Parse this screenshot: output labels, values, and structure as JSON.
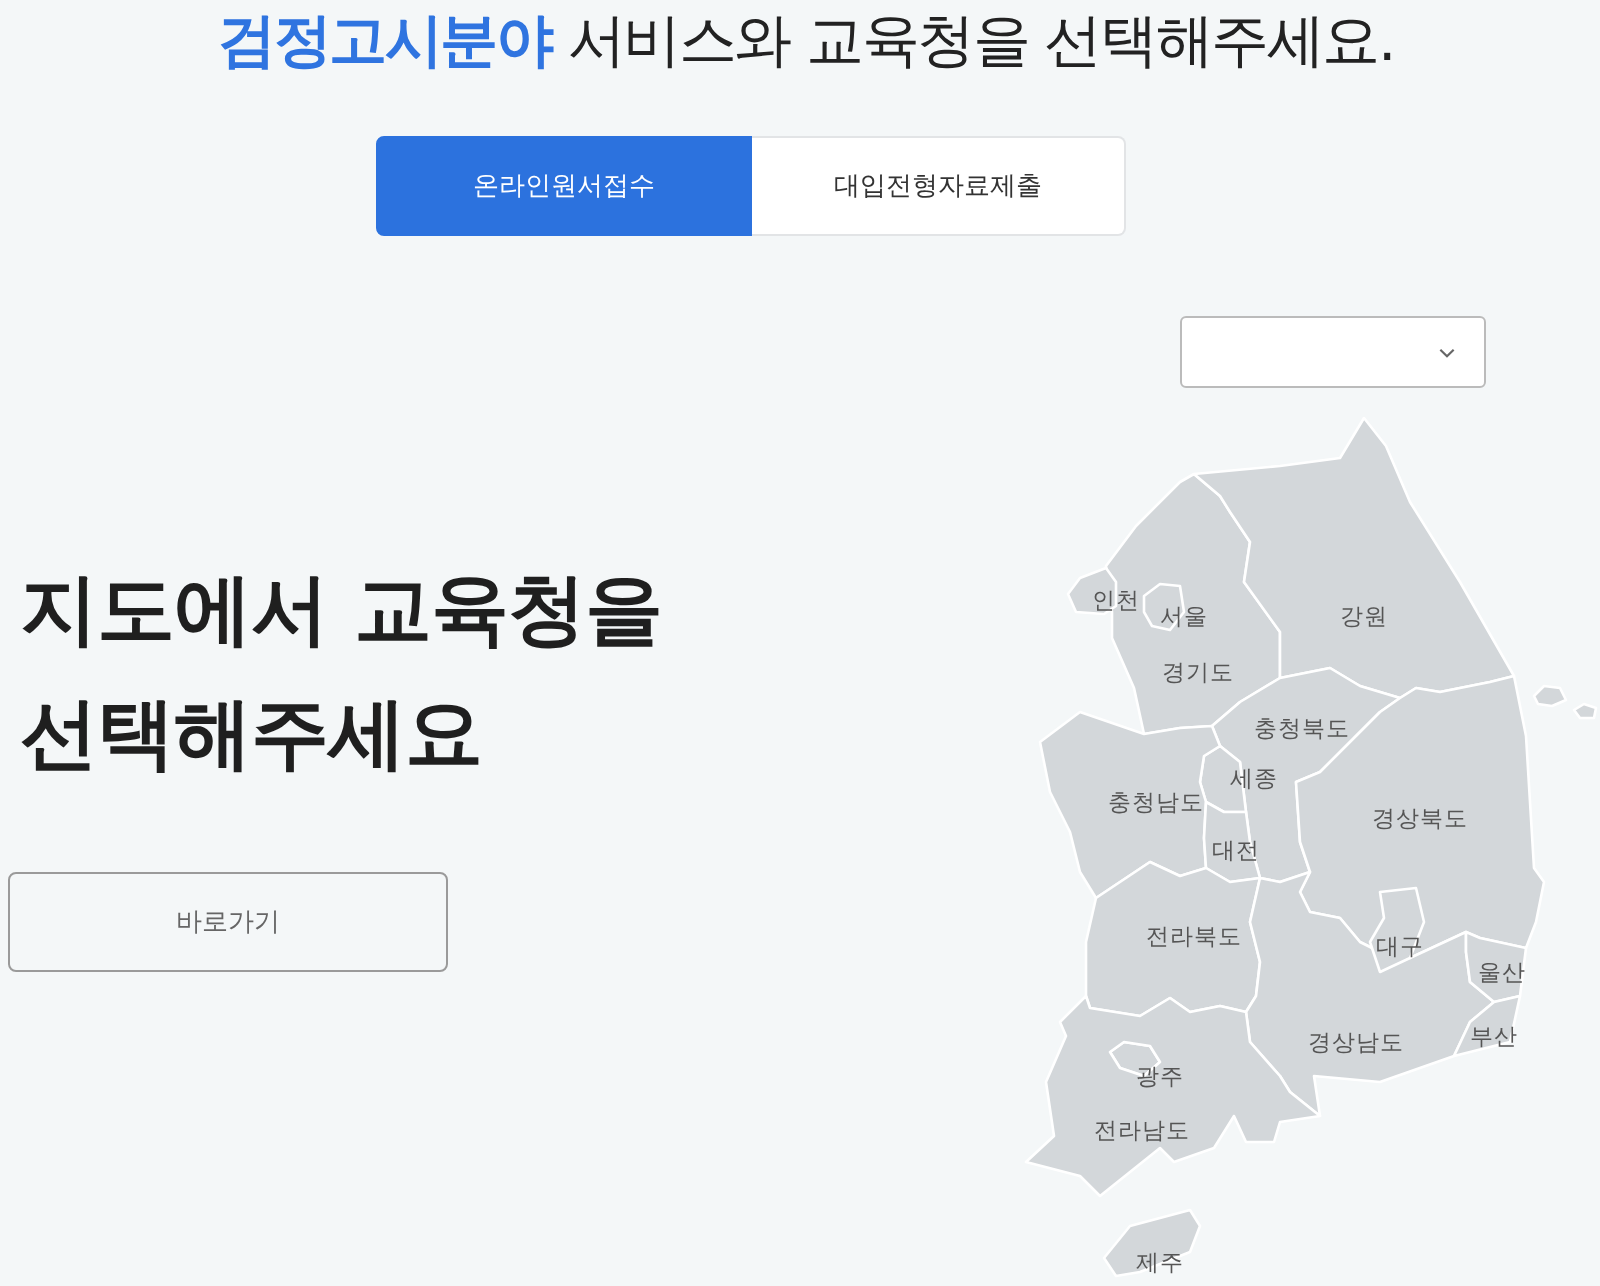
{
  "headline": "**검정고시분야** 서비스와 교육청을 선택해주세요.",
  "tabs": [
    {
      "label": "온라인원서접수",
      "selected": true
    },
    {
      "label": "대입전형자료제출",
      "selected": false
    }
  ],
  "heading": "지도에서 교육청을 선택해주세요",
  "shortcut_button": "바로가기",
  "map": {
    "regions": [
      {
        "name": "경기도"
      },
      {
        "name": "인천"
      },
      {
        "name": "서울"
      },
      {
        "name": "강원"
      },
      {
        "name": "충청북도"
      },
      {
        "name": "세종"
      },
      {
        "name": "충청남도"
      },
      {
        "name": "대전"
      },
      {
        "name": "경상북도"
      },
      {
        "name": "전라북도"
      },
      {
        "name": "경상남도"
      },
      {
        "name": "대구"
      },
      {
        "name": "울산"
      },
      {
        "name": "부산"
      },
      {
        "name": "광주"
      },
      {
        "name": "전라남도"
      },
      {
        "name": "제주"
      }
    ]
  }
}
